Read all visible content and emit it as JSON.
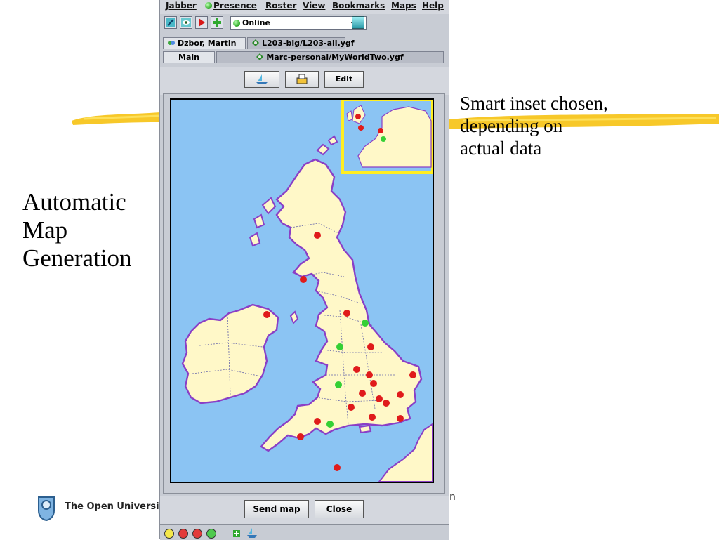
{
  "slide": {
    "heading": [
      "Automatic",
      "Map",
      "Generation"
    ],
    "annotation": [
      "Smart inset chosen,",
      "depending on",
      "actual data"
    ],
    "university": "The Open University",
    "trailing_char": "n"
  },
  "app": {
    "menu": [
      {
        "label": "Jabber"
      },
      {
        "label": "Presence",
        "icon": "green-dot-icon"
      },
      {
        "label": "Roster"
      },
      {
        "label": "View"
      },
      {
        "label": "Bookmarks"
      },
      {
        "label": "Maps"
      },
      {
        "label": "Help"
      }
    ],
    "toolbar": {
      "status_value": "Online",
      "buttons": [
        "connect-icon",
        "eye-icon",
        "play-icon",
        "add-icon"
      ]
    },
    "tabs_row1": [
      {
        "label": "Dzbor, Martin",
        "icon": "contact-icon",
        "active": true
      },
      {
        "label": "L203-big/L203-all.ygf",
        "icon": "map-diamond-icon",
        "active": false
      }
    ],
    "tabs_row2": [
      {
        "label": "Main",
        "active": true
      },
      {
        "label": "Marc-personal/MyWorldTwo.ygf",
        "icon": "map-diamond-icon",
        "active": false
      }
    ],
    "actions": {
      "edit_label": "Edit"
    },
    "footer": {
      "send_label": "Send map",
      "close_label": "Close"
    },
    "status_dots": [
      "#f5e84a",
      "#e23a3a",
      "#e23a3a",
      "#4ec94e"
    ],
    "colors": {
      "sea": "#8bc4f3",
      "land": "#fff8c8",
      "coast": "#8a3fc6",
      "red_marker": "#e01b1b",
      "green_marker": "#35d035",
      "inset_border": "#ffee22"
    }
  }
}
